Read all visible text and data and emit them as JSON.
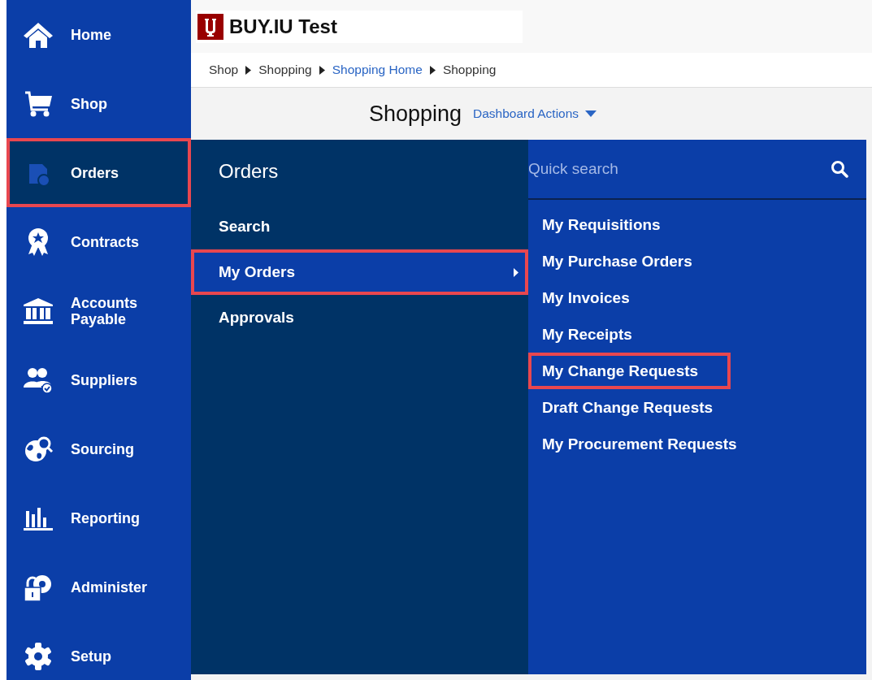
{
  "sidebar": {
    "items": [
      {
        "label": "Home",
        "selected": false,
        "highlighted": false
      },
      {
        "label": "Shop",
        "selected": false,
        "highlighted": false
      },
      {
        "label": "Orders",
        "selected": true,
        "highlighted": true
      },
      {
        "label": "Contracts",
        "selected": false,
        "highlighted": false
      },
      {
        "label": "Accounts Payable",
        "selected": false,
        "highlighted": false
      },
      {
        "label": "Suppliers",
        "selected": false,
        "highlighted": false
      },
      {
        "label": "Sourcing",
        "selected": false,
        "highlighted": false
      },
      {
        "label": "Reporting",
        "selected": false,
        "highlighted": false
      },
      {
        "label": "Administer",
        "selected": false,
        "highlighted": false
      },
      {
        "label": "Setup",
        "selected": false,
        "highlighted": false
      }
    ]
  },
  "header": {
    "title": "BUY.IU Test"
  },
  "breadcrumb": [
    {
      "label": "Shop",
      "link": false
    },
    {
      "label": "Shopping",
      "link": false
    },
    {
      "label": "Shopping Home",
      "link": true
    },
    {
      "label": "Shopping",
      "link": false
    }
  ],
  "page": {
    "title": "Shopping",
    "actions_label": "Dashboard Actions"
  },
  "flyout": {
    "title": "Orders",
    "items": [
      {
        "label": "Search",
        "selected": false,
        "highlighted": false,
        "has_submenu": false
      },
      {
        "label": "My Orders",
        "selected": true,
        "highlighted": true,
        "has_submenu": true
      },
      {
        "label": "Approvals",
        "selected": false,
        "highlighted": false,
        "has_submenu": false
      }
    ]
  },
  "submenu": {
    "search": {
      "placeholder": "Quick search"
    },
    "items": [
      {
        "label": "My Requisitions",
        "highlighted": false
      },
      {
        "label": "My Purchase Orders",
        "highlighted": false
      },
      {
        "label": "My Invoices",
        "highlighted": false
      },
      {
        "label": "My Receipts",
        "highlighted": false
      },
      {
        "label": "My Change Requests",
        "highlighted": true
      },
      {
        "label": "Draft Change Requests",
        "highlighted": false
      },
      {
        "label": "My Procurement Requests",
        "highlighted": false
      }
    ]
  }
}
